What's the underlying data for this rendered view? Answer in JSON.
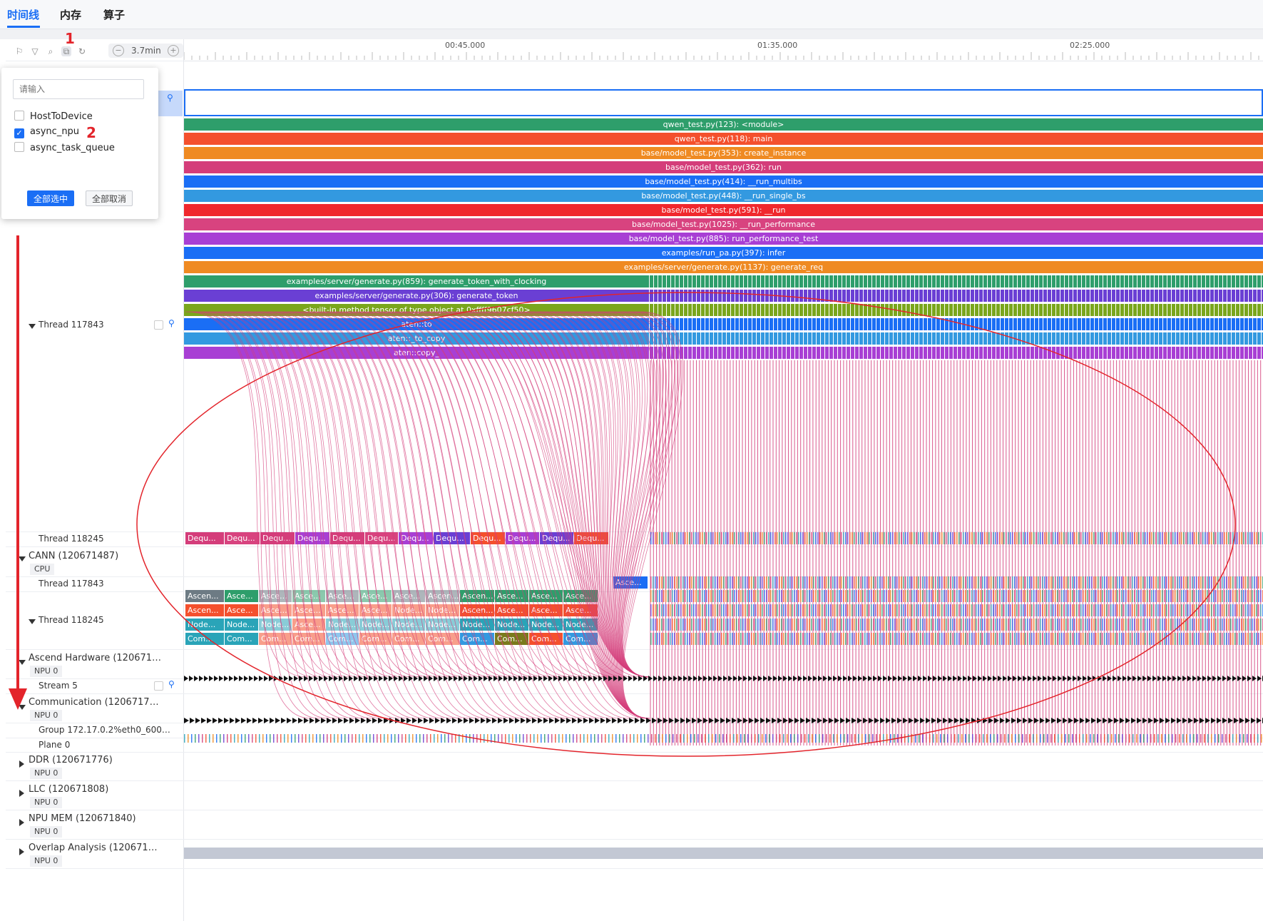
{
  "tabs": [
    {
      "label": "时间线",
      "active": true
    },
    {
      "label": "内存",
      "active": false
    },
    {
      "label": "算子",
      "active": false
    }
  ],
  "toolbar": {
    "icons": [
      "flag-icon",
      "filter-icon",
      "search-icon",
      "link-filter-icon",
      "reset-icon"
    ],
    "zoom_value": "3.7min",
    "annotation_1": "1"
  },
  "ruler": {
    "ticks": [
      "00:45.000",
      "01:35.000",
      "02:25.000"
    ]
  },
  "popup": {
    "search_placeholder": "请输入",
    "options": [
      {
        "label": "HostToDevice",
        "checked": false
      },
      {
        "label": "async_npu",
        "checked": true
      },
      {
        "label": "async_task_queue",
        "checked": false
      }
    ],
    "select_all": "全部选中",
    "deselect_all": "全部取消",
    "annotation_2": "2"
  },
  "tracks": {
    "thread_117843_python": "Thread 117843",
    "thread_118245_a": "Thread 118245",
    "cann": {
      "name": "CANN (120671487)",
      "badge": "CPU"
    },
    "thread_117843_cann": "Thread 117843",
    "thread_118245_cann": "Thread 118245",
    "ascend_hw": {
      "name": "Ascend Hardware (120671…",
      "badge": "NPU 0"
    },
    "stream5": "Stream 5",
    "communication": {
      "name": "Communication (1206717…",
      "badge": "NPU 0"
    },
    "group": "Group 172.17.0.2%eth0_600…",
    "plane0": "Plane 0",
    "ddr": {
      "name": "DDR (120671776)",
      "badge": "NPU 0"
    },
    "llc": {
      "name": "LLC (120671808)",
      "badge": "NPU 0"
    },
    "npu_mem": {
      "name": "NPU MEM (120671840)",
      "badge": "NPU 0"
    },
    "overlap": {
      "name": "Overlap Analysis (120671…",
      "badge": "NPU 0"
    }
  },
  "call_stack": [
    {
      "label": "qwen_test.py(123): <module>",
      "color": "#2e9e6b"
    },
    {
      "label": "qwen_test.py(118): main",
      "color": "#f4502d"
    },
    {
      "label": "base/model_test.py(353): create_instance",
      "color": "#ef8a22"
    },
    {
      "label": "base/model_test.py(362): run",
      "color": "#d43d7a"
    },
    {
      "label": "base/model_test.py(414): __run_multibs",
      "color": "#1a6ef5"
    },
    {
      "label": "base/model_test.py(448): __run_single_bs",
      "color": "#3399e0"
    },
    {
      "label": "base/model_test.py(591): __run",
      "color": "#f0282d"
    },
    {
      "label": "base/model_test.py(1025): __run_performance",
      "color": "#d8437f"
    },
    {
      "label": "base/model_test.py(885): run_performance_test",
      "color": "#a83fd4"
    },
    {
      "label": "examples/run_pa.py(397): infer",
      "color": "#1a6ef5"
    },
    {
      "label": "examples/server/generate.py(1137): generate_req",
      "color": "#ef8a22"
    }
  ],
  "split_stack": [
    {
      "label": "examples/server/generate.py(859): generate_token_with_clocking",
      "color": "#2e9e6b"
    },
    {
      "label": "examples/server/generate.py(306): generate_token",
      "color": "#6a3fd4"
    },
    {
      "label": "<built-in method tensor of type object at 0xffff9607cf50>",
      "color": "#7aa61c"
    },
    {
      "label": "aten::to",
      "color": "#1a6ef5"
    },
    {
      "label": "aten::_to_copy",
      "color": "#3399e0"
    },
    {
      "label": "aten::copy_",
      "color": "#a83fd4"
    }
  ],
  "dequeue_slices": [
    "Dequ...",
    "Dequ...",
    "Dequ...",
    "Dequ...",
    "Dequ...",
    "Dequ...",
    "Dequ...",
    "Dequ...",
    "Dequ...",
    "Dequ...",
    "Dequ...",
    "Dequ..."
  ],
  "cann_ascend_slice": "Asce...",
  "cann_rows": [
    [
      "Ascen...",
      "Asce...",
      "Asce...",
      "Asce...",
      "Asce...",
      "Asce...",
      "Asce...",
      "Ascen...",
      "Ascen...",
      "Asce...",
      "Asce...",
      "Asce..."
    ],
    [
      "Ascen...",
      "Asce...",
      "Asce...",
      "Asce...",
      "Asce...",
      "Asce...",
      "Node...",
      "Node...",
      "Ascen...",
      "Asce...",
      "Asce...",
      "Asce..."
    ],
    [
      "Node...",
      "Node...",
      "Node...",
      "Asce...",
      "Node...",
      "Node...",
      "Node...",
      "Node...",
      "Node...",
      "Node...",
      "Node...",
      "Node..."
    ],
    [
      "Com...",
      "Com...",
      "Com...",
      "Com...",
      "Com...",
      "Com...",
      "Com...",
      "Com...",
      "Com...",
      "Com...",
      "Com...",
      "Com..."
    ]
  ],
  "colors": {
    "accent": "#1a6ef5",
    "flow_arrows": "#d43d7a",
    "annotation_red": "#e3242b",
    "overlap_bar": "#c3c8d4"
  }
}
